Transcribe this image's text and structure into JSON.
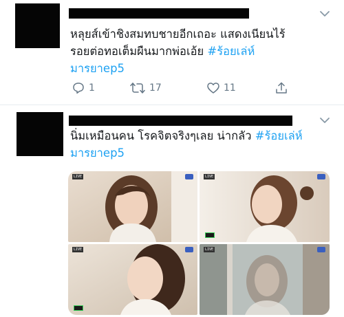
{
  "tweets": [
    {
      "text_line1": "หลุยส์เข้าชิงสมทบชายอีกเถอะ แสดงเนียนไร้",
      "text_line2_prefix": "รอยต่อทอเต็มผืนมากพ่อเอ้ย ",
      "hashtag_line2": "#ร้อยเล่ห์",
      "hashtag_line3": "มารยาep5",
      "reply_count": "1",
      "retweet_count": "17",
      "like_count": "11"
    },
    {
      "text_line1_prefix": "นิ่มเหมือนคน โรคจิตจริงๆเลย น่ากลัว ",
      "hashtag_line1": "#ร้อยเล่ห์",
      "hashtag_line2": "มารยาep5",
      "media": [
        {
          "badge": "LIVE"
        },
        {
          "badge": "LIVE"
        },
        {
          "badge": "LIVE"
        },
        {
          "badge": "LIVE"
        }
      ]
    }
  ],
  "icons": {
    "reply": "reply-icon",
    "retweet": "retweet-icon",
    "like": "heart-icon",
    "share": "share-icon",
    "caret": "chevron-down-icon"
  },
  "colors": {
    "hashtag": "#1da1f2",
    "secondary": "#657786",
    "divider": "#e6ecf0"
  }
}
